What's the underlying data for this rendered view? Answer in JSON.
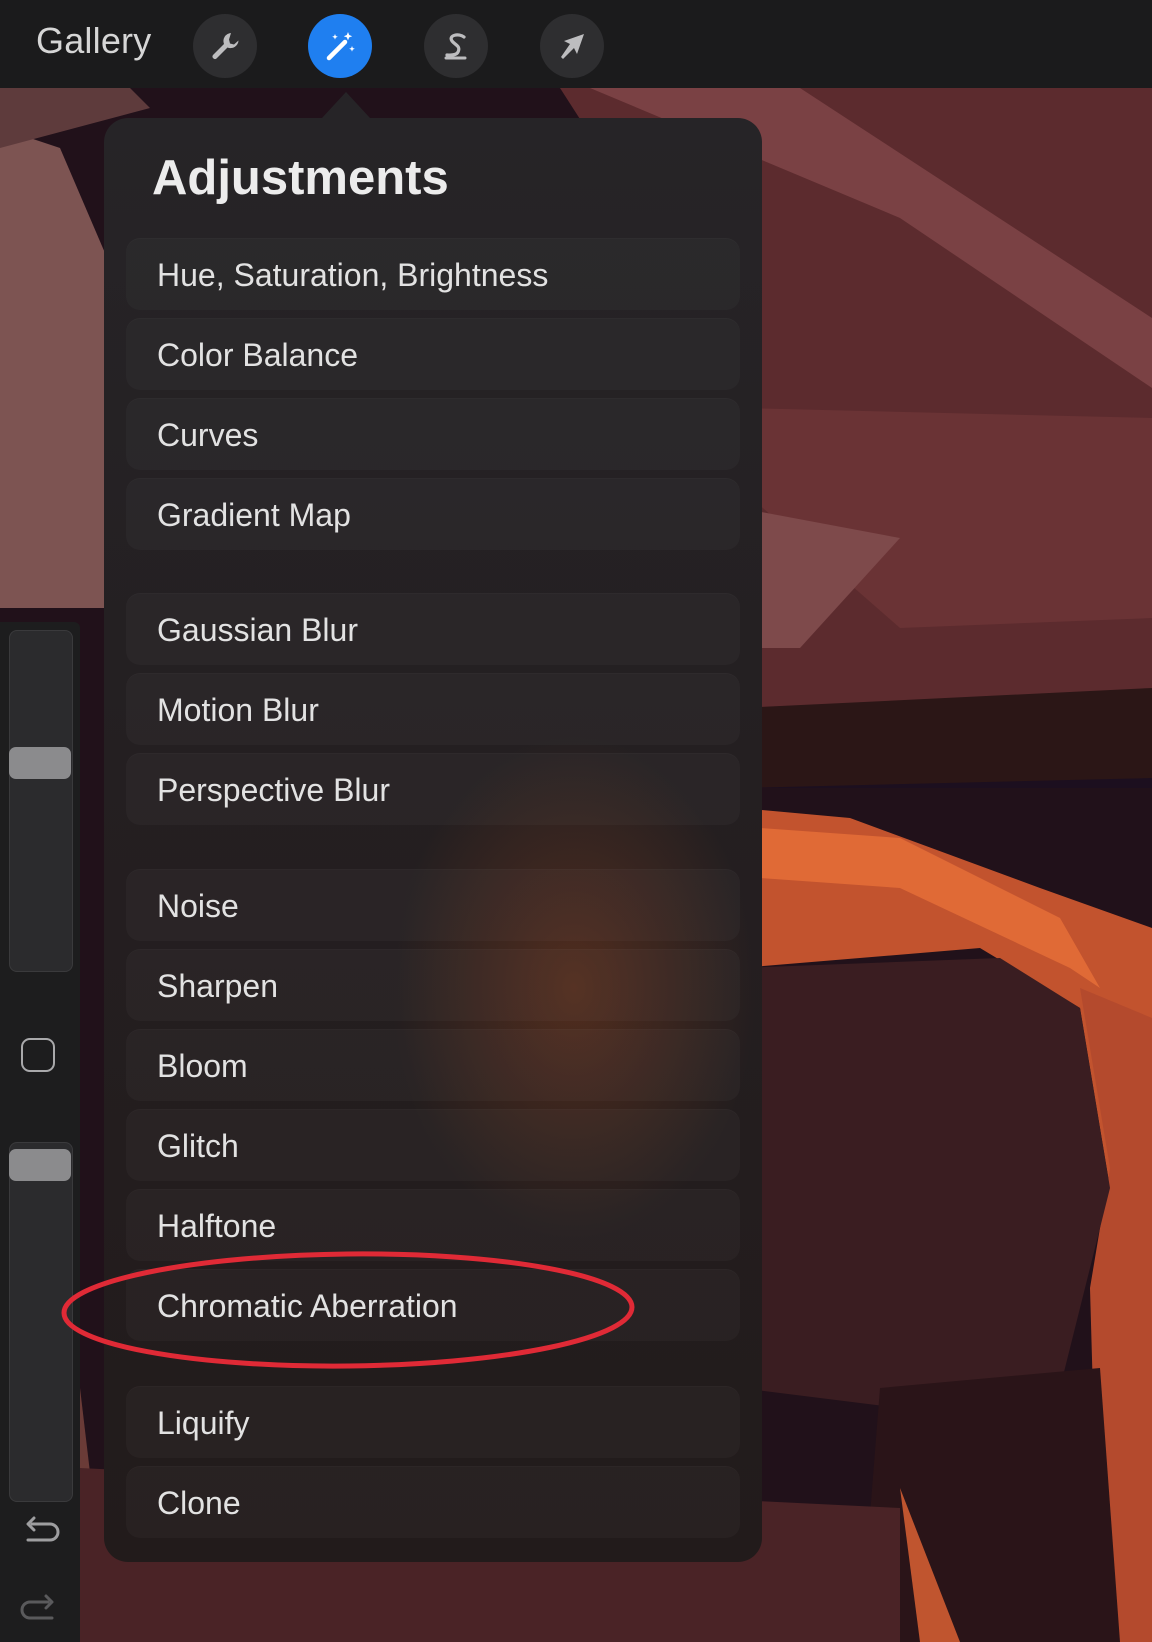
{
  "toolbar": {
    "gallery_label": "Gallery",
    "tools": [
      {
        "name": "actions",
        "icon": "wrench-icon"
      },
      {
        "name": "adjustments",
        "icon": "magic-wand-icon",
        "active": true
      },
      {
        "name": "selection",
        "icon": "selection-s-icon"
      },
      {
        "name": "transform",
        "icon": "arrow-cursor-icon"
      }
    ]
  },
  "colors": {
    "active_tool": "#1f7ff0",
    "highlight": "#e02a36",
    "popover_bg": "#262427"
  },
  "adjustments": {
    "title": "Adjustments",
    "items": [
      "Hue, Saturation, Brightness",
      "Color Balance",
      "Curves",
      "Gradient Map",
      "Gaussian Blur",
      "Motion Blur",
      "Perspective Blur",
      "Noise",
      "Sharpen",
      "Bloom",
      "Glitch",
      "Halftone",
      "Chromatic Aberration",
      "Liquify",
      "Clone"
    ],
    "highlighted_item": "Chromatic Aberration"
  },
  "sidebar": {
    "brush_size_level": 0.62,
    "opacity_level": 0.98,
    "buttons": [
      "square-modify-icon",
      "undo-icon",
      "redo-icon"
    ]
  }
}
